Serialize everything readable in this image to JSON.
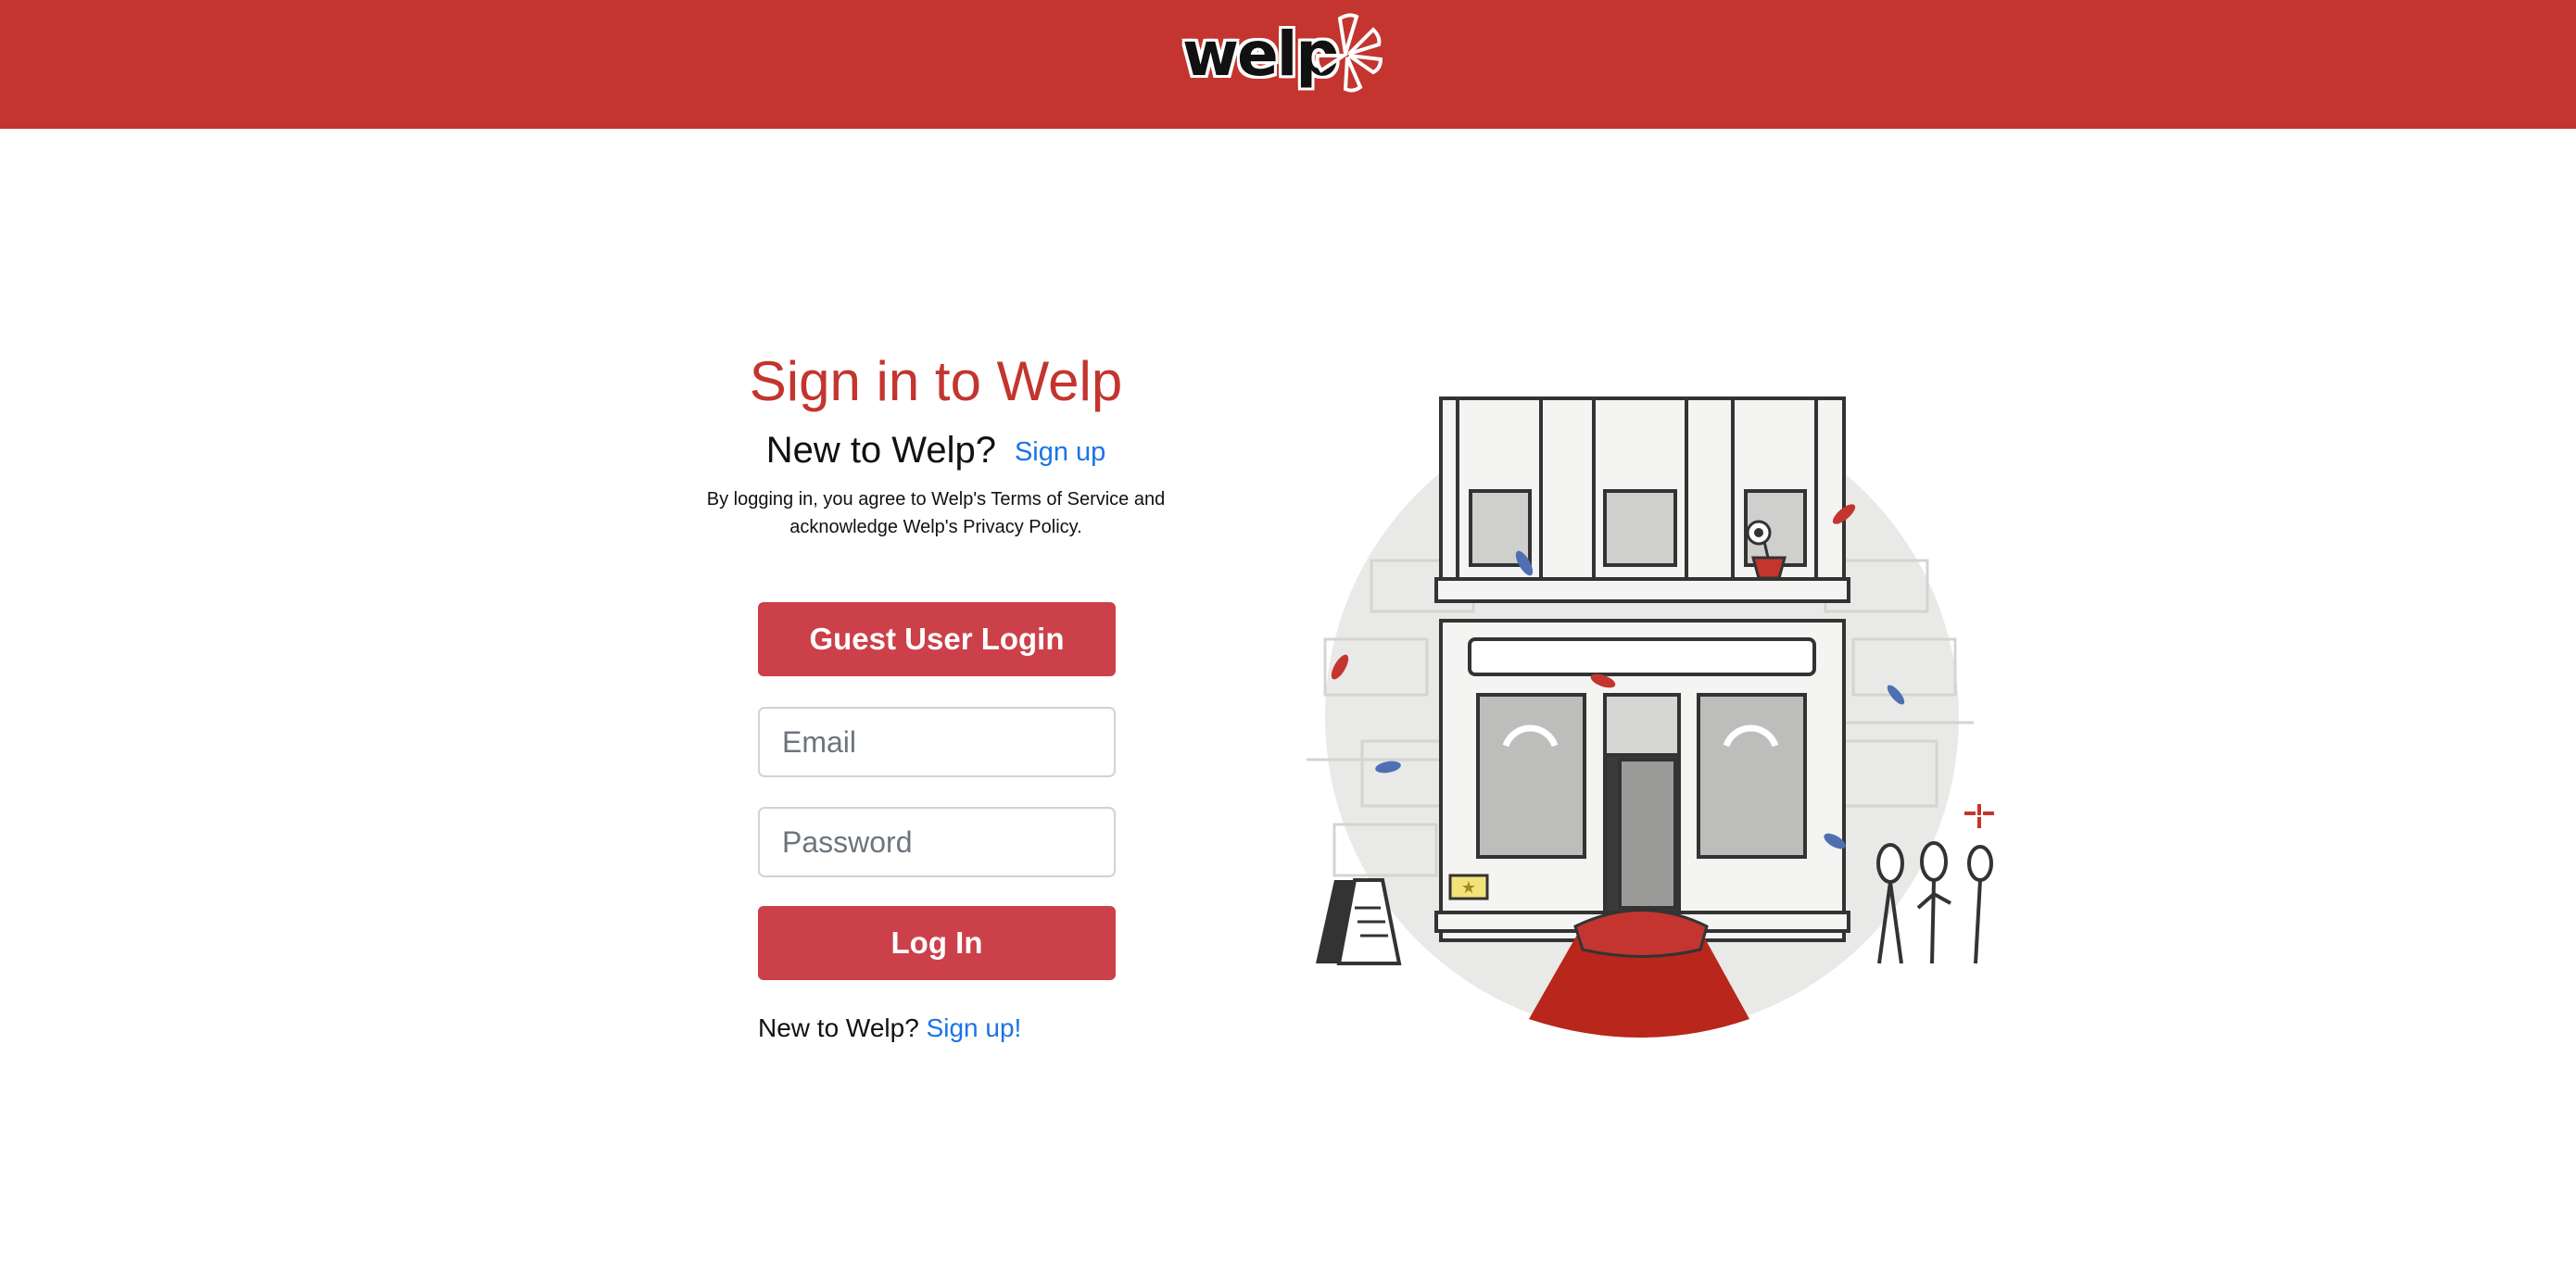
{
  "header": {
    "logo_text": "welp",
    "brand_color": "#c3352e"
  },
  "signin": {
    "title": "Sign in to Welp",
    "subtitle": "New to Welp?",
    "signup_link": "Sign up",
    "legal_line1": "By logging in, you agree to Welp's Terms of Service and",
    "legal_line2": "acknowledge Welp's Privacy Policy.",
    "guest_button": "Guest User Login",
    "email_placeholder": "Email",
    "password_placeholder": "Password",
    "login_button": "Log In",
    "bottom_text": "New to Welp?",
    "bottom_link": "Sign up!"
  },
  "colors": {
    "button": "#cc4049",
    "link": "#1a73e8",
    "title": "#c3352e"
  },
  "icons": {
    "logo_burst": "burst-icon",
    "illustration": "storefront-illustration"
  }
}
